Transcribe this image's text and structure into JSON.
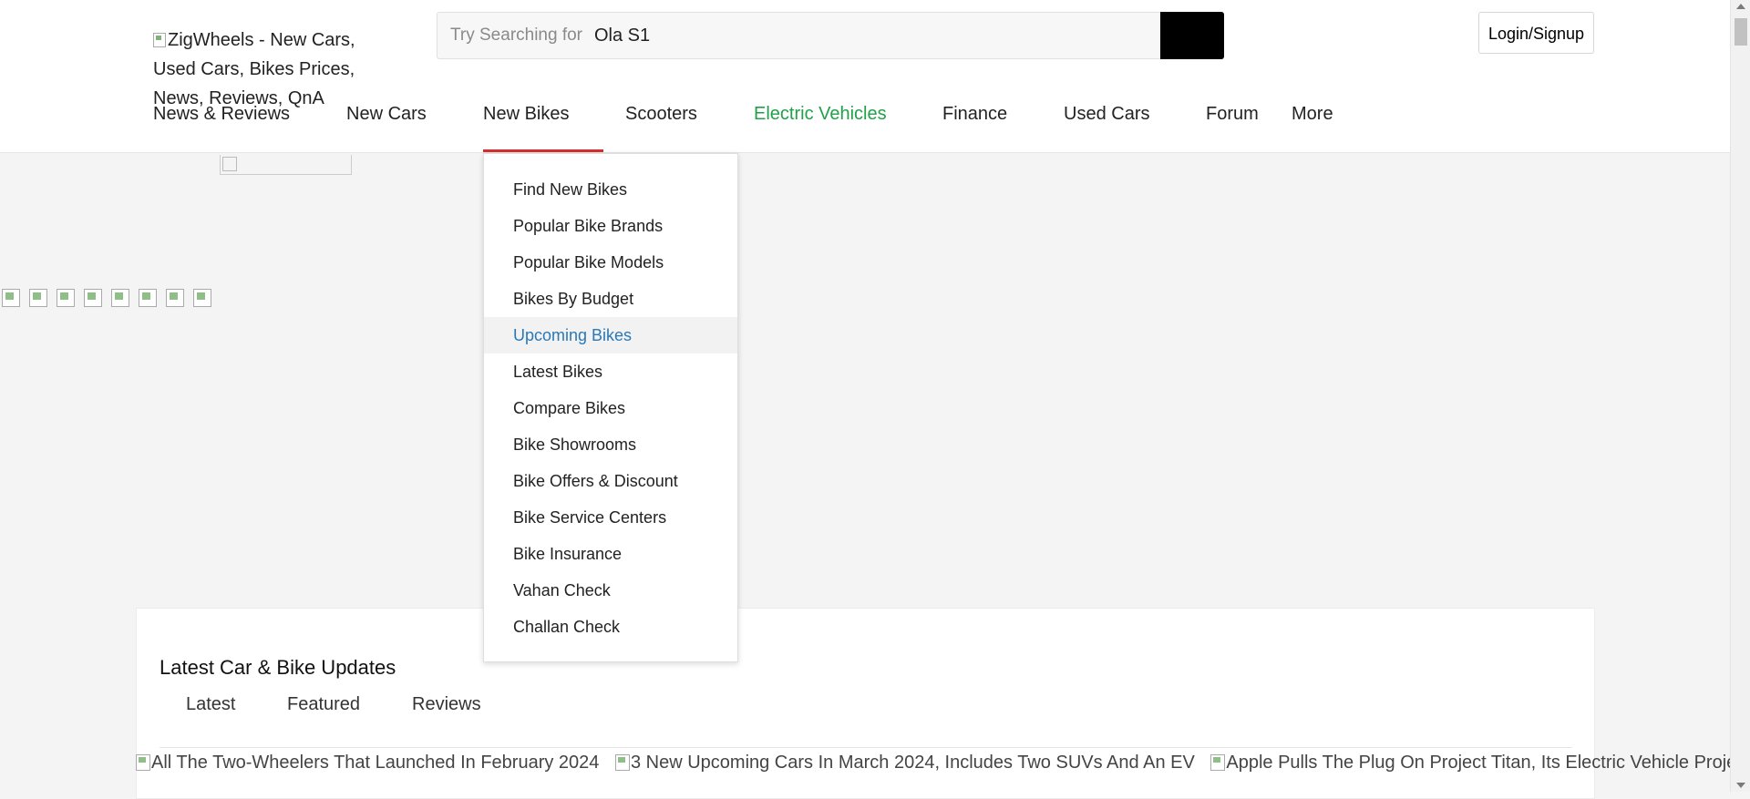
{
  "header": {
    "logo_alt": "ZigWheels - New Cars, Used Cars, Bikes Prices, News, Reviews, QnA",
    "search": {
      "prefix": "Try Searching for",
      "value": "Ola S1"
    },
    "login_label": "Login/Signup"
  },
  "nav": {
    "items": [
      {
        "label": "News & Reviews"
      },
      {
        "label": "New Cars"
      },
      {
        "label": "New Bikes"
      },
      {
        "label": "Scooters"
      },
      {
        "label": "Electric Vehicles"
      },
      {
        "label": "Finance"
      },
      {
        "label": "Used Cars"
      },
      {
        "label": "Forum"
      },
      {
        "label": "More"
      }
    ],
    "active": "New Bikes",
    "colors": {
      "active_underline": "#d62e2e",
      "ev": "#21a04a",
      "hover_link": "#2b78b5"
    }
  },
  "dropdown": {
    "items": [
      {
        "label": "Find New Bikes"
      },
      {
        "label": "Popular Bike Brands"
      },
      {
        "label": "Popular Bike Models"
      },
      {
        "label": "Bikes By Budget"
      },
      {
        "label": "Upcoming Bikes"
      },
      {
        "label": "Latest Bikes"
      },
      {
        "label": "Compare Bikes"
      },
      {
        "label": "Bike Showrooms"
      },
      {
        "label": "Bike Offers & Discount"
      },
      {
        "label": "Bike Service Centers"
      },
      {
        "label": "Bike Insurance"
      },
      {
        "label": "Vahan Check"
      },
      {
        "label": "Challan Check"
      }
    ],
    "hovered": "Upcoming Bikes"
  },
  "updates": {
    "title": "Latest Car & Bike Updates",
    "tabs": [
      {
        "label": "Latest"
      },
      {
        "label": "Featured"
      },
      {
        "label": "Reviews"
      }
    ],
    "articles": [
      {
        "alt": "All The Two-Wheelers That Launched In February 2024"
      },
      {
        "alt": "3 New Upcoming Cars In March 2024, Includes Two SUVs And An EV"
      },
      {
        "alt": "Apple Pulls The Plug On Project Titan, Its Electric Vehicle Project"
      }
    ]
  }
}
